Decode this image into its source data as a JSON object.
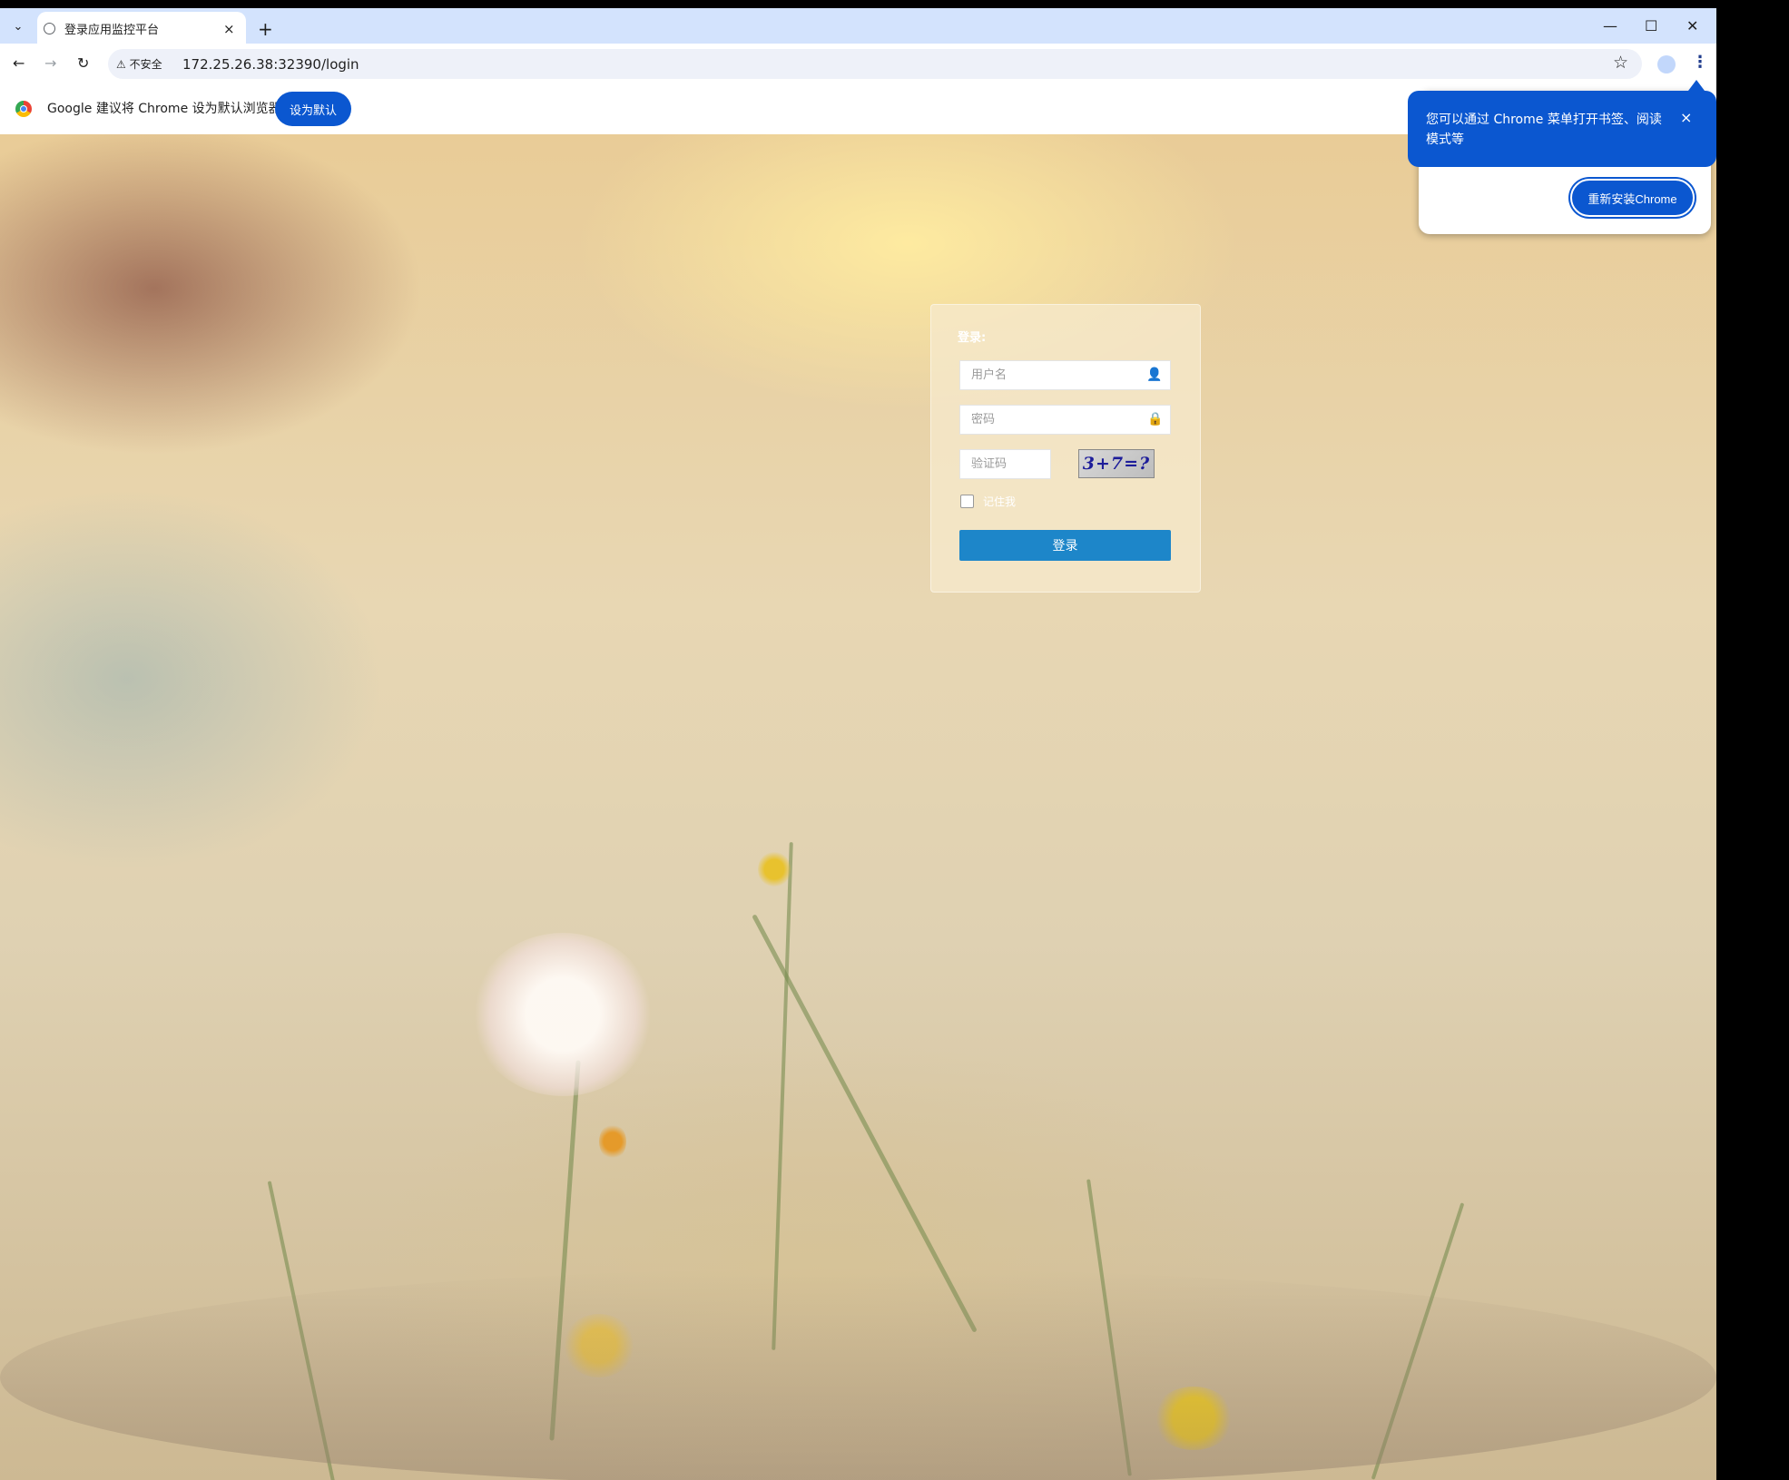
{
  "browser": {
    "tab_title": "登录应用监控平台",
    "new_tab": "+",
    "tab_close": "×",
    "url": "172.25.26.38:32390/login",
    "security_label": "不安全",
    "window_controls": {
      "minimize": "—",
      "maximize": "☐",
      "close": "✕"
    }
  },
  "infobar": {
    "message": "Google 建议将 Chrome 设为默认浏览器",
    "button": "设为默认"
  },
  "popup": {
    "message": "您可以通过 Chrome 菜单打开书签、阅读模式等",
    "button": "重新安装Chrome",
    "close": "×"
  },
  "login": {
    "title": "登录:",
    "username_placeholder": "用户名",
    "password_placeholder": "密码",
    "captcha_placeholder": "验证码",
    "captcha_text": "3+7=?",
    "remember_label": "记住我",
    "submit": "登录"
  },
  "colors": {
    "accent": "#0b57d0",
    "login_button": "#1d86c9",
    "tabstrip": "#d3e3fd"
  }
}
